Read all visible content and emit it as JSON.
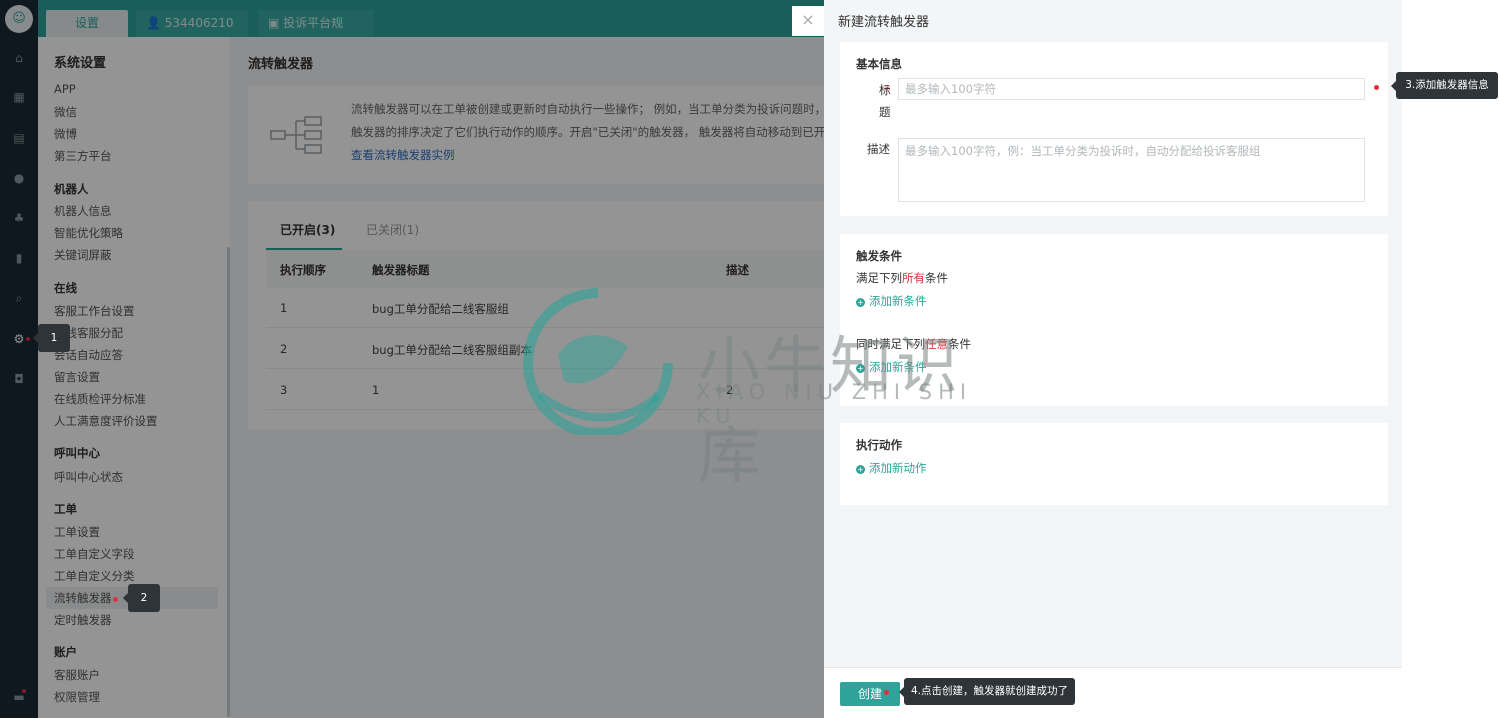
{
  "rail": {
    "logo_glyph": "☺",
    "icons": [
      "home-icon",
      "grid-icon",
      "document-icon",
      "user-icon",
      "users-icon",
      "chart-icon",
      "search-icon",
      "gear-icon",
      "monitor-icon",
      "chat-icon"
    ]
  },
  "tabs": [
    {
      "label": "设置"
    },
    {
      "icon": "👤",
      "label": "534406210"
    },
    {
      "icon": "▣",
      "label": "投诉平台规"
    }
  ],
  "sidebar": {
    "title": "系统设置",
    "groups": [
      {
        "title": "",
        "items": [
          "APP",
          "微信",
          "微博",
          "第三方平台"
        ]
      },
      {
        "title": "机器人",
        "items": [
          "机器人信息",
          "智能优化策略",
          "关键词屏蔽"
        ]
      },
      {
        "title": "在线",
        "items": [
          "客服工作台设置",
          "在线客服分配",
          "会话自动应答",
          "留言设置",
          "在线质检评分标准",
          "人工满意度评价设置"
        ]
      },
      {
        "title": "呼叫中心",
        "items": [
          "呼叫中心状态"
        ]
      },
      {
        "title": "工单",
        "items": [
          "工单设置",
          "工单自定义字段",
          "工单自定义分类",
          "流转触发器",
          "定时触发器"
        ]
      },
      {
        "title": "账户",
        "items": [
          "客服账户",
          "权限管理"
        ]
      }
    ]
  },
  "main": {
    "title": "流转触发器",
    "info_lines": [
      "流转触发器可以在工单被创建或更新时自动执行一些操作； 例如，当工单分类为投诉问题时，把",
      "触发器的排序决定了它们执行动作的顺序。开启\"已关闭\"的触发器， 触发器将自动移动到已开启"
    ],
    "info_link": "查看流转触发器实例",
    "tab_on": "已开启(3)",
    "tab_off": "已关闭(1)",
    "columns": [
      "执行顺序",
      "触发器标题",
      "描述"
    ],
    "rows": [
      {
        "order": "1",
        "title": "bug工单分配给二线客服组",
        "desc": ""
      },
      {
        "order": "2",
        "title": "bug工单分配给二线客服组副本",
        "desc": ""
      },
      {
        "order": "3",
        "title": "1",
        "desc": "2"
      }
    ]
  },
  "drawer": {
    "title": "新建流转触发器",
    "close": "×",
    "basic": {
      "heading": "基本信息",
      "title_label_1": "标",
      "title_label_2": "题",
      "title_placeholder": "最多输入100字符",
      "desc_label": "描述",
      "desc_placeholder": "最多输入100字符，例：当工单分类为投诉时，自动分配给投诉客服组"
    },
    "conditions": {
      "heading": "触发条件",
      "all_pre": "满足下列",
      "all_red": "所有",
      "all_post": "条件",
      "add_all": "添加新条件",
      "any_pre": "同时满足下列",
      "any_red": "任意",
      "any_post": "条件",
      "add_any": "添加新条件"
    },
    "actions": {
      "heading": "执行动作",
      "add": "添加新动作"
    },
    "create_button": "创建"
  },
  "tips": {
    "t1": "1",
    "t2": "2",
    "t3": "3.添加触发器信息",
    "t4": "4.点击创建，触发器就创建成功了"
  },
  "watermark": {
    "cn": "小牛知识库",
    "en": "XIAO NIU ZHI SHI KU"
  },
  "colors": {
    "accent": "#2ea39a",
    "rail": "#1b2a34",
    "red": "#e0303a",
    "link": "#2a6fc9"
  }
}
